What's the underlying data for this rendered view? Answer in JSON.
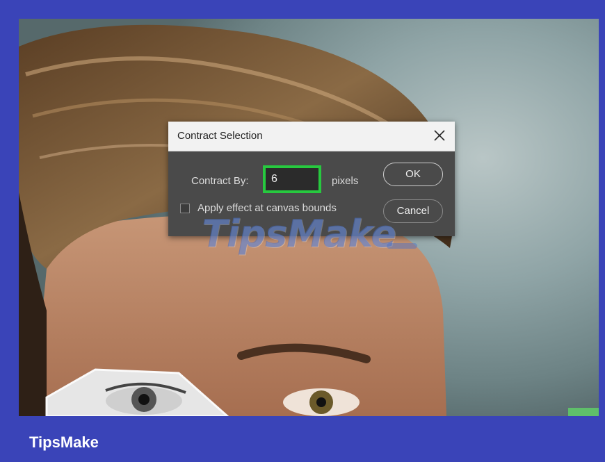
{
  "dialog": {
    "title": "Contract Selection",
    "contract_label": "Contract By:",
    "contract_value": "6",
    "units": "pixels",
    "checkbox_label": "Apply effect at canvas bounds",
    "checkbox_checked": false,
    "ok_label": "OK",
    "cancel_label": "Cancel"
  },
  "watermark": {
    "text": "TipsMake"
  },
  "footer": {
    "brand": "TipsMake"
  },
  "colors": {
    "frame_background": "#3a44b8",
    "dialog_background": "#4a4a4a",
    "highlight_border": "#27c93f"
  }
}
